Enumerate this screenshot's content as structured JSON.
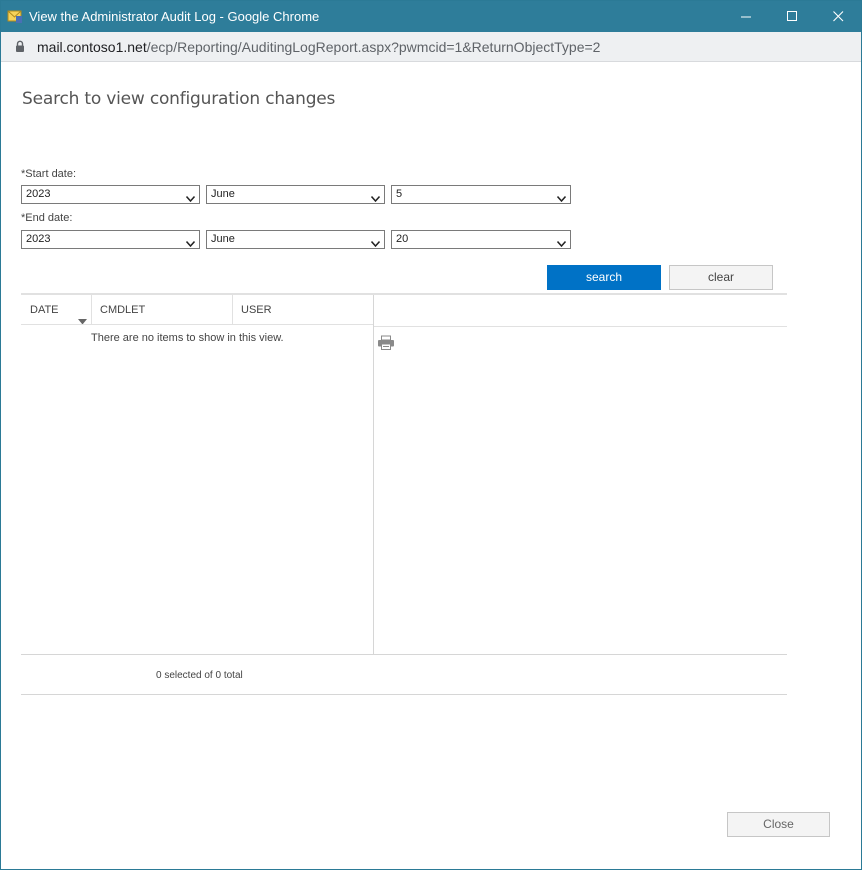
{
  "window": {
    "title": "View the Administrator Audit Log - Google Chrome",
    "minimize_icon": "minimize-icon",
    "maximize_icon": "maximize-icon",
    "close_icon": "close-icon"
  },
  "address_bar": {
    "host": "mail.contoso1.net",
    "path": "/ecp/Reporting/AuditingLogReport.aspx?pwmcid=1&ReturnObjectType=2",
    "icon": "lock-icon"
  },
  "page": {
    "heading": "Search to view configuration changes"
  },
  "search_form": {
    "start_date": {
      "label": "*Start date:",
      "year": "2023",
      "month": "June",
      "day": "5"
    },
    "end_date": {
      "label": "*End date:",
      "year": "2023",
      "month": "June",
      "day": "20"
    },
    "search_label": "search",
    "clear_label": "clear"
  },
  "results": {
    "columns": [
      "DATE",
      "CMDLET",
      "USER"
    ],
    "sort_icon": "sort-desc-icon",
    "empty_message": "There are no items to show in this view.",
    "status": "0 selected of 0 total",
    "print_icon": "printer-icon"
  },
  "footer": {
    "close_label": "Close"
  },
  "colors": {
    "title_bar": "#2e7d9a",
    "primary_button": "#0072c6"
  }
}
